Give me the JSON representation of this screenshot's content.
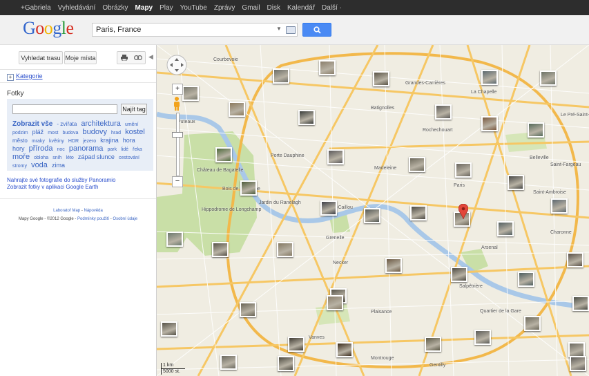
{
  "topbar": {
    "items": [
      "+Gabriela",
      "Vyhledávání",
      "Obrázky",
      "Mapy",
      "Play",
      "YouTube",
      "Zprávy",
      "Gmail",
      "Disk",
      "Kalendář",
      "Další ·"
    ],
    "active_index": 3
  },
  "header": {
    "logo": "Google",
    "search_value": "Paris, France",
    "search_icon": "magnifier-icon",
    "keyboard_icon": "keyboard-icon"
  },
  "panel": {
    "toolbar": {
      "route_label": "Vyhledat trasu",
      "places_label": "Moje místa",
      "print_icon": "print-icon",
      "link_icon": "link-icon",
      "collapse_icon": "chevron-left-icon"
    },
    "categories_label": "Kategorie",
    "photos_heading": "Fotky",
    "tag_input_value": "",
    "find_tag_label": "Najít tag",
    "tags": [
      {
        "text": "Zobrazit vše",
        "size": "b"
      },
      {
        "text": "- zvířata",
        "size": "2"
      },
      {
        "text": "architektura",
        "size": "4"
      },
      {
        "text": "umění",
        "size": "1"
      },
      {
        "text": "podzim",
        "size": "1"
      },
      {
        "text": "pláž",
        "size": "3"
      },
      {
        "text": "most",
        "size": "1"
      },
      {
        "text": "budova",
        "size": "1"
      },
      {
        "text": "budovy",
        "size": "4"
      },
      {
        "text": "hrad",
        "size": "1"
      },
      {
        "text": "kostel",
        "size": "4"
      },
      {
        "text": "město",
        "size": "2"
      },
      {
        "text": "mraky",
        "size": "1"
      },
      {
        "text": "květiny",
        "size": "1"
      },
      {
        "text": "HDR",
        "size": "1"
      },
      {
        "text": "jezero",
        "size": "1"
      },
      {
        "text": "krajina",
        "size": "3"
      },
      {
        "text": "hora",
        "size": "3"
      },
      {
        "text": "hory",
        "size": "3"
      },
      {
        "text": "příroda",
        "size": "4"
      },
      {
        "text": "noc",
        "size": "1"
      },
      {
        "text": "panorama",
        "size": "4"
      },
      {
        "text": "park",
        "size": "1"
      },
      {
        "text": "lidé",
        "size": "1"
      },
      {
        "text": "řeka",
        "size": "1"
      },
      {
        "text": "moře",
        "size": "4"
      },
      {
        "text": "obloha",
        "size": "1"
      },
      {
        "text": "sníh",
        "size": "1"
      },
      {
        "text": "léto",
        "size": "1"
      },
      {
        "text": "západ slunce",
        "size": "3"
      },
      {
        "text": "cestování",
        "size": "1"
      },
      {
        "text": "stromy",
        "size": "1"
      },
      {
        "text": "voda",
        "size": "4"
      },
      {
        "text": "zima",
        "size": "3"
      }
    ],
    "upload_link": "Nahrajte své fotografie do služby Panoramio",
    "earth_link": "Zobrazit fotky v aplikaci Google Earth",
    "footer_line1_a": "Laboratoř Map",
    "footer_line1_b": "Nápověda",
    "footer_line2_a": "Mapy Google - ©2012 Google -",
    "footer_line2_b": "Podmínky použití",
    "footer_line2_c": "Osobní údaje"
  },
  "map": {
    "labels": [
      {
        "text": "Courbevoie"
      },
      {
        "text": "Puteaux"
      },
      {
        "text": "Grandes-Carrières"
      },
      {
        "text": "Batignolles"
      },
      {
        "text": "Rochechouart"
      },
      {
        "text": "Madeleine"
      },
      {
        "text": "Bois de Boulogne"
      },
      {
        "text": "Gros-Caillou"
      },
      {
        "text": "Plaisance"
      },
      {
        "text": "Montrouge"
      },
      {
        "text": "Salpêtrière"
      },
      {
        "text": "Charonne"
      },
      {
        "text": "Belleville"
      },
      {
        "text": "Le Pré-Saint-Gervais"
      },
      {
        "text": "Saint-Fargeau"
      },
      {
        "text": "Saint-Ambroise"
      },
      {
        "text": "Necker"
      },
      {
        "text": "Vanves"
      },
      {
        "text": "Gentilly"
      },
      {
        "text": "Quartier de la Gare"
      },
      {
        "text": "Arsenal"
      },
      {
        "text": "Porte Dauphine"
      },
      {
        "text": "Grenelle"
      },
      {
        "text": "Jardin du Ranelagh"
      },
      {
        "text": "Hippodrome de Longchamp"
      },
      {
        "text": "Château de Bagatelle"
      },
      {
        "text": "Paris"
      },
      {
        "text": "La Chapelle"
      }
    ],
    "scale_label": "1 km",
    "scale_ft": "5000 st.",
    "pan_icon": "pan-control-icon",
    "pegman_icon": "pegman-icon",
    "zoom_in_icon": "zoom-in-icon",
    "zoom_out_icon": "zoom-out-icon",
    "marker_icon": "location-marker-icon"
  },
  "colors": {
    "topbar": "#2d2d2d",
    "search_button": "#4a8af4",
    "link": "#2a4ecc",
    "park": "#c9dfa7",
    "water": "#a9c8e8",
    "road_major": "#f6c764",
    "marker": "#e2463a"
  }
}
